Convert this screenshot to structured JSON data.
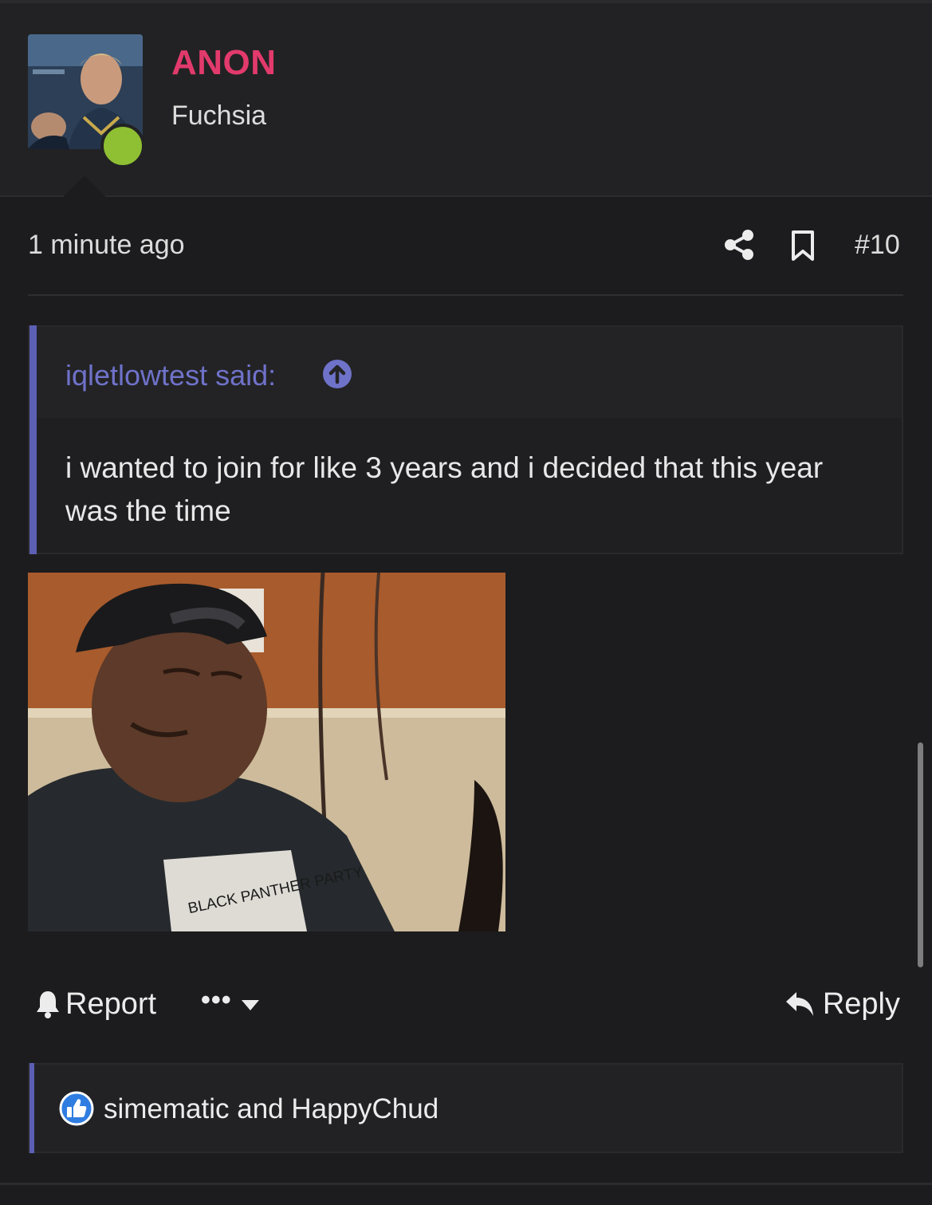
{
  "user": {
    "name": "ANON",
    "title": "Fuchsia",
    "name_color": "#e23a6c",
    "online_status_color": "#8fbf32"
  },
  "post": {
    "time": "1 minute ago",
    "number": "#10",
    "icons": [
      "share-icon",
      "bookmark-icon"
    ]
  },
  "quote": {
    "author_line": "iqletlowtest said:",
    "jump_icon": "arrow-up-circle-icon",
    "text": "i wanted to join for like 3 years and i decided that this year was the time",
    "accent_color": "#5c5fb3"
  },
  "image": {
    "shirt_text": "BLACK PANTHER PARTY"
  },
  "actions": {
    "report_label": "Report",
    "more_label": "•••",
    "reply_label": "Reply"
  },
  "reactions": {
    "icon": "thumbs-up-icon",
    "text": "simematic and HappyChud"
  }
}
